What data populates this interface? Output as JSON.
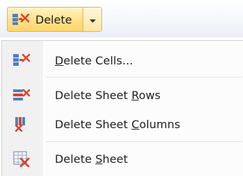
{
  "ribbon": {
    "delete_button": {
      "label": "Delete",
      "icon": "delete-cells-icon",
      "dropdown_icon": "chevron-down-icon"
    }
  },
  "menu": {
    "items": [
      {
        "label": "Delete Cells...",
        "accel_pre": "",
        "accel": "D",
        "accel_post": "elete Cells...",
        "icon": "delete-cells-icon"
      },
      {
        "label": "Delete Sheet Rows",
        "accel_pre": "Delete Sheet ",
        "accel": "R",
        "accel_post": "ows",
        "icon": "delete-rows-icon"
      },
      {
        "label": "Delete Sheet Columns",
        "accel_pre": "Delete Sheet ",
        "accel": "C",
        "accel_post": "olumns",
        "icon": "delete-columns-icon"
      },
      {
        "label": "Delete Sheet",
        "accel_pre": "Delete ",
        "accel": "S",
        "accel_post": "heet",
        "icon": "delete-sheet-icon"
      }
    ]
  },
  "colors": {
    "highlight_fill": "#ffe18a",
    "highlight_border": "#e0b54d",
    "delete_red": "#e0402a",
    "grid_blue": "#4f7fc1"
  }
}
